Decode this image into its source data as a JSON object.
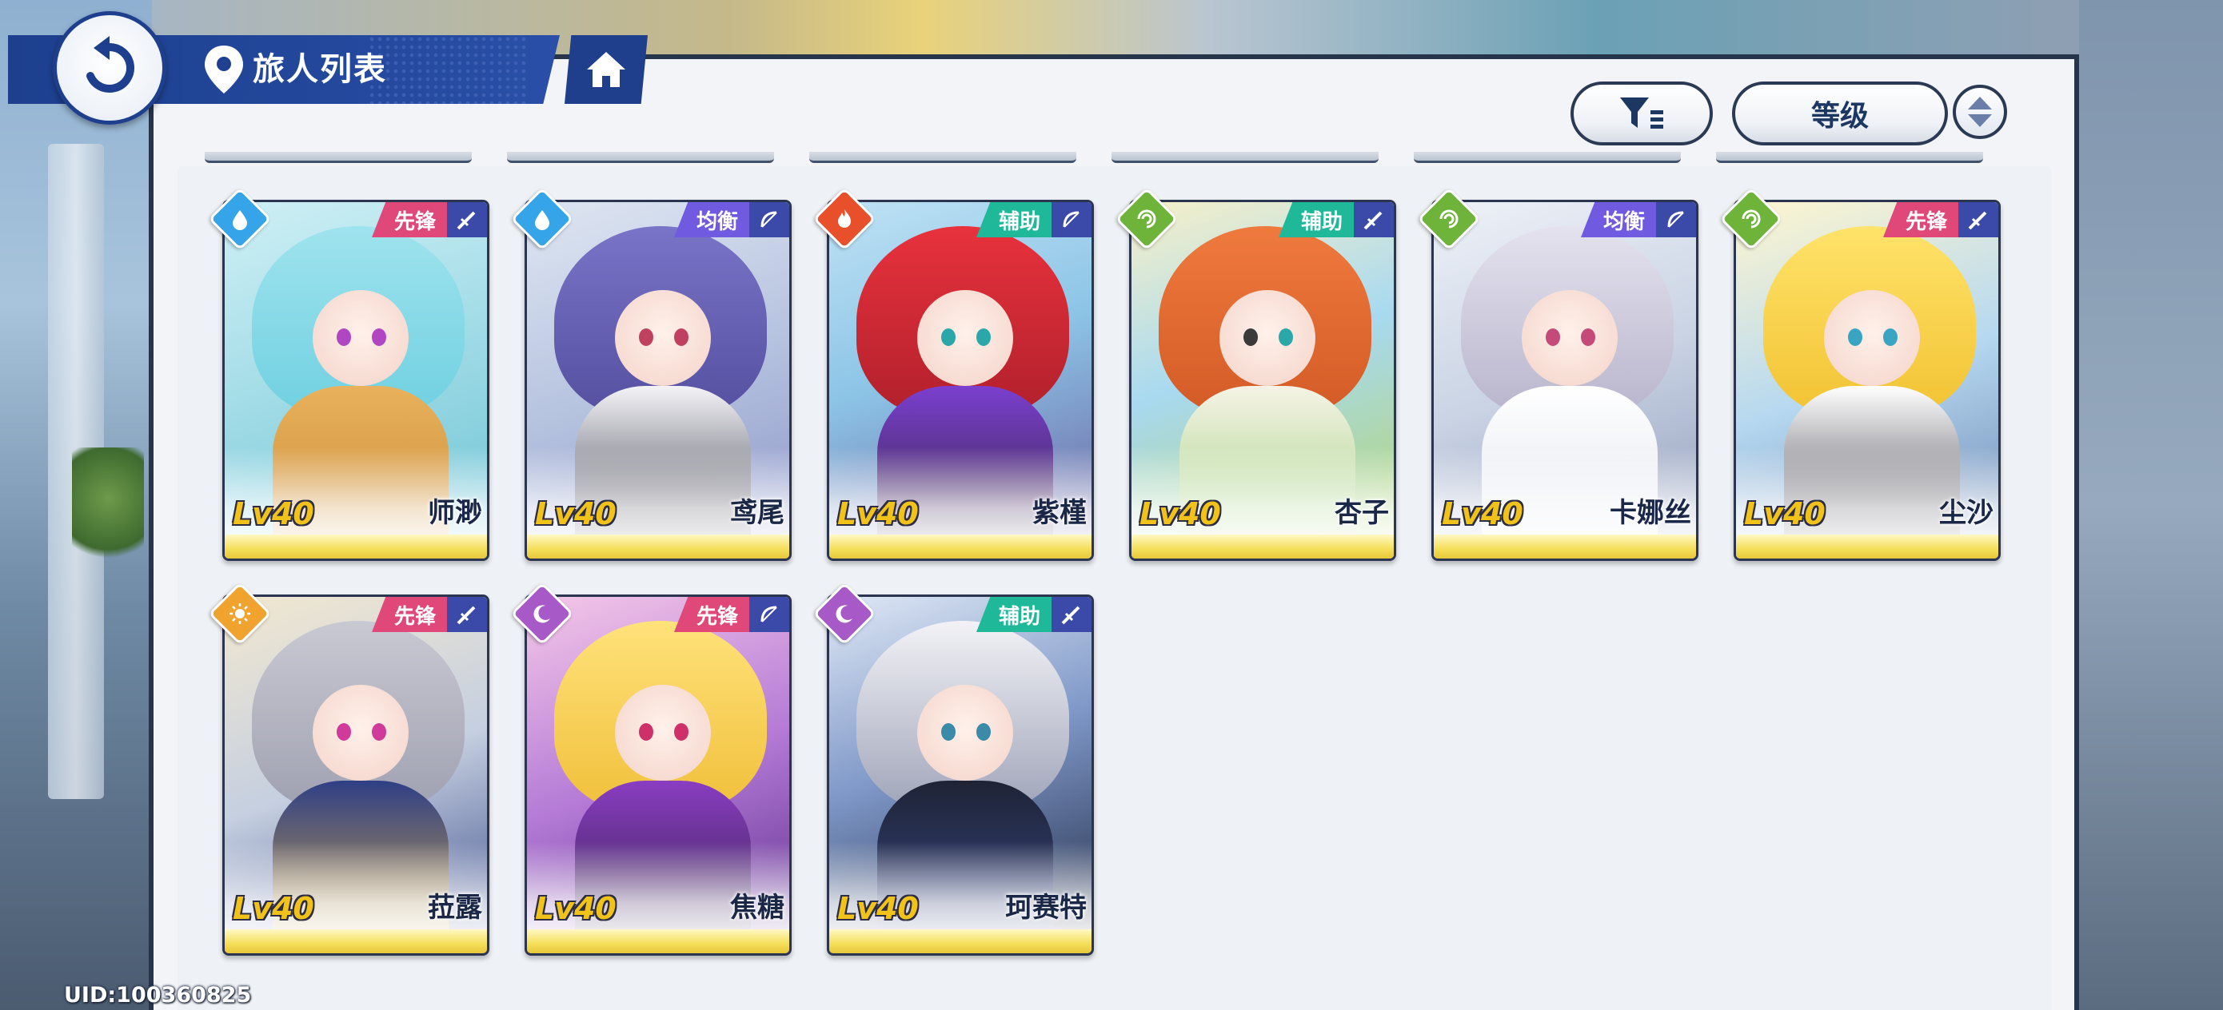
{
  "header": {
    "title": "旅人列表"
  },
  "controls": {
    "sort_label": "等级"
  },
  "footer": {
    "uid": "UID:100360825"
  },
  "colors": {
    "vanguard": "#e0487a",
    "balance": "#6f5ae0",
    "support": "#1fb99a",
    "water": "#36a4e8",
    "fire": "#e8502c",
    "wind": "#6fb43a",
    "light": "#f0a32e",
    "dark": "#a75ac7"
  },
  "cards": [
    {
      "level": "Lv40",
      "name": "师渺",
      "role": "先锋",
      "element": "water-icon",
      "weapon": "sword-icon"
    },
    {
      "level": "Lv40",
      "name": "鸢尾",
      "role": "均衡",
      "element": "water-icon",
      "weapon": "bow-icon"
    },
    {
      "level": "Lv40",
      "name": "紫槿",
      "role": "辅助",
      "element": "fire-icon",
      "weapon": "bow-icon"
    },
    {
      "level": "Lv40",
      "name": "杏子",
      "role": "辅助",
      "element": "wind-icon",
      "weapon": "sword-icon"
    },
    {
      "level": "Lv40",
      "name": "卡娜丝",
      "role": "均衡",
      "element": "wind-icon",
      "weapon": "bow-icon"
    },
    {
      "level": "Lv40",
      "name": "尘沙",
      "role": "先锋",
      "element": "wind-icon",
      "weapon": "sword-icon"
    },
    {
      "level": "Lv40",
      "name": "菈露",
      "role": "先锋",
      "element": "light-icon",
      "weapon": "sword-icon"
    },
    {
      "level": "Lv40",
      "name": "焦糖",
      "role": "先锋",
      "element": "dark-icon",
      "weapon": "bow-icon"
    },
    {
      "level": "Lv40",
      "name": "珂赛特",
      "role": "辅助",
      "element": "dark-icon",
      "weapon": "sword-icon"
    }
  ]
}
